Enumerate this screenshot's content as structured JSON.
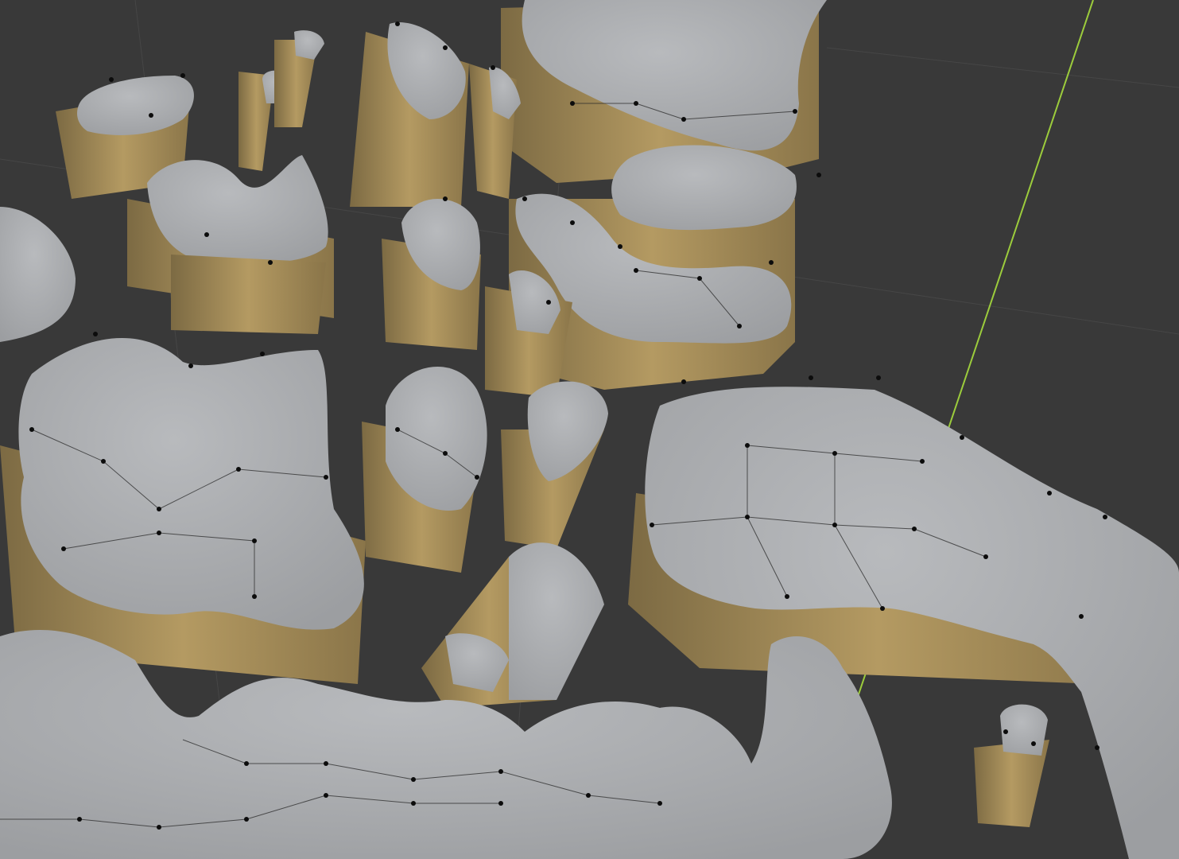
{
  "app": {
    "viewport_title": "",
    "mode": "edit-mesh"
  },
  "colors": {
    "background": "#393939",
    "grid_line": "#464646",
    "face_top": "#a6a8ab",
    "face_top_highlight": "#c9cbce",
    "face_side": "#8f7a4f",
    "face_side_light": "#b59c63",
    "wire": "#2a2a2a",
    "vertex": "#0c0c0c",
    "y_axis": "#9ccc3c"
  },
  "icons": {
    "axis": "y-axis-line",
    "vertex": "vertex-dot"
  }
}
